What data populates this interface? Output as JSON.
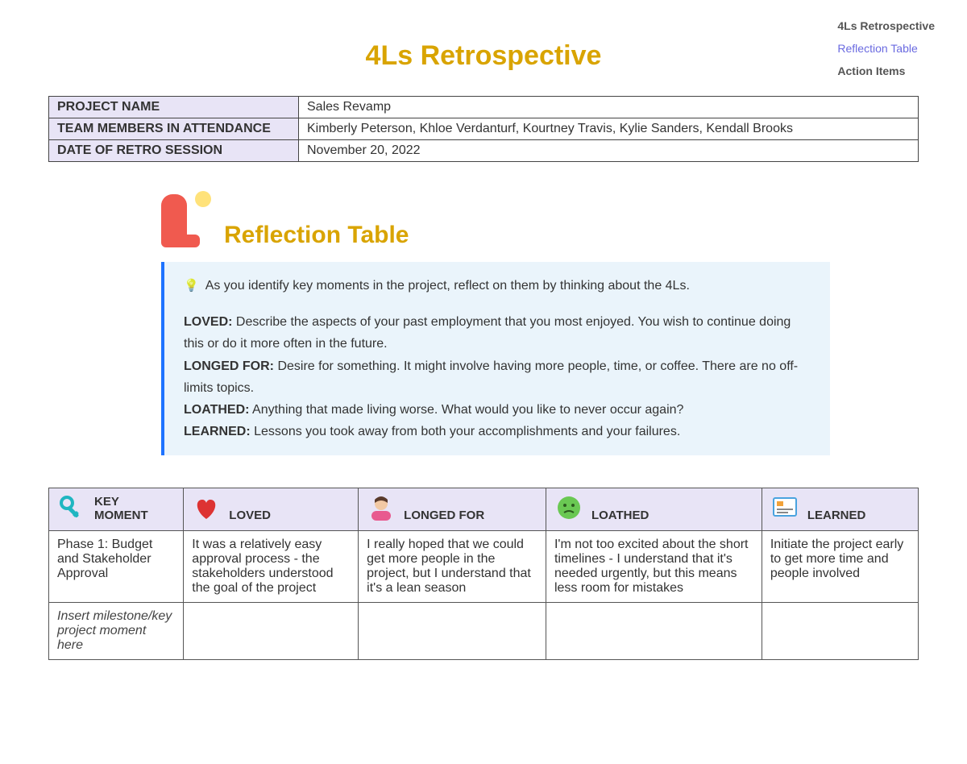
{
  "toc": {
    "items": [
      "4Ls Retrospective",
      "Reflection Table",
      "Action Items"
    ],
    "activeIndex": 1
  },
  "title": "4Ls Retrospective",
  "meta": {
    "rows": [
      {
        "label": "PROJECT NAME",
        "value": "Sales Revamp"
      },
      {
        "label": "TEAM MEMBERS IN ATTENDANCE",
        "value": "Kimberly Peterson, Khloe Verdanturf, Kourtney Travis, Kylie Sanders, Kendall Brooks"
      },
      {
        "label": "DATE OF RETRO SESSION",
        "value": "November 20, 2022"
      }
    ]
  },
  "reflection": {
    "heading": "Reflection Table",
    "callout": {
      "lead": "As you identify key moments in the project, reflect on them by thinking about the 4Ls.",
      "items": [
        {
          "term": "LOVED:",
          "desc": "Describe the aspects of your past employment that you most enjoyed. You wish to continue doing this or do it more often in the future."
        },
        {
          "term": "LONGED FOR:",
          "desc": "Desire for something.  It might involve having more people, time, or coffee. There are no off-limits topics."
        },
        {
          "term": "LOATHED:",
          "desc": "Anything that made living worse. What would you like to never occur again?"
        },
        {
          "term": "LEARNED:",
          "desc": "Lessons you took away from both your accomplishments and your failures."
        }
      ]
    },
    "columns": [
      "KEY MOMENT",
      "LOVED",
      "LONGED FOR",
      "LOATHED",
      "LEARNED"
    ],
    "rows": [
      {
        "cells": [
          "Phase 1: Budget and Stakeholder Approval",
          "It was a relatively easy approval process - the stakeholders understood the goal of the project",
          "I really hoped that we could get more people in the project, but I understand that it's a lean season",
          "I'm not too excited about the short timelines - I understand that it's needed urgently, but this means less room for mistakes",
          "Initiate the project early to get more time and people involved"
        ]
      },
      {
        "placeholder": true,
        "cells": [
          "Insert milestone/key project moment here",
          "",
          "",
          "",
          ""
        ]
      }
    ]
  }
}
